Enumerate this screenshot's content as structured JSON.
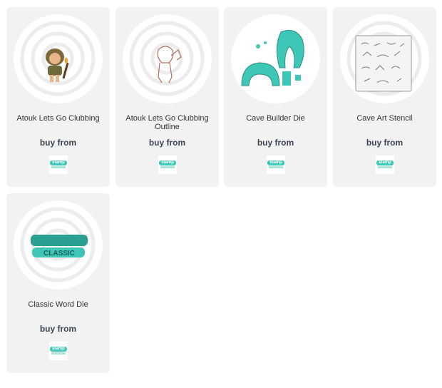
{
  "products": [
    {
      "name": "Atouk Lets Go Clubbing",
      "buy_label": "buy from",
      "image": "caveman-clubbing-stamp",
      "store_logo_text": "stamp"
    },
    {
      "name": "Atouk Lets Go Clubbing Outline",
      "buy_label": "buy from",
      "image": "caveman-outline-stamp",
      "store_logo_text": "stamp"
    },
    {
      "name": "Cave Builder Die",
      "buy_label": "buy from",
      "image": "cave-builder-die",
      "store_logo_text": "stamp"
    },
    {
      "name": "Cave Art Stencil",
      "buy_label": "buy from",
      "image": "cave-art-stencil",
      "store_logo_text": "stamp"
    },
    {
      "name": "Classic Word Die",
      "buy_label": "buy from",
      "image": "classic-word-die",
      "store_logo_text": "stamp",
      "image_text": "CLASSIC"
    }
  ],
  "colors": {
    "card_bg": "#f2f2f2",
    "accent": "#3ec7b7",
    "buy_text": "#3a4555"
  }
}
